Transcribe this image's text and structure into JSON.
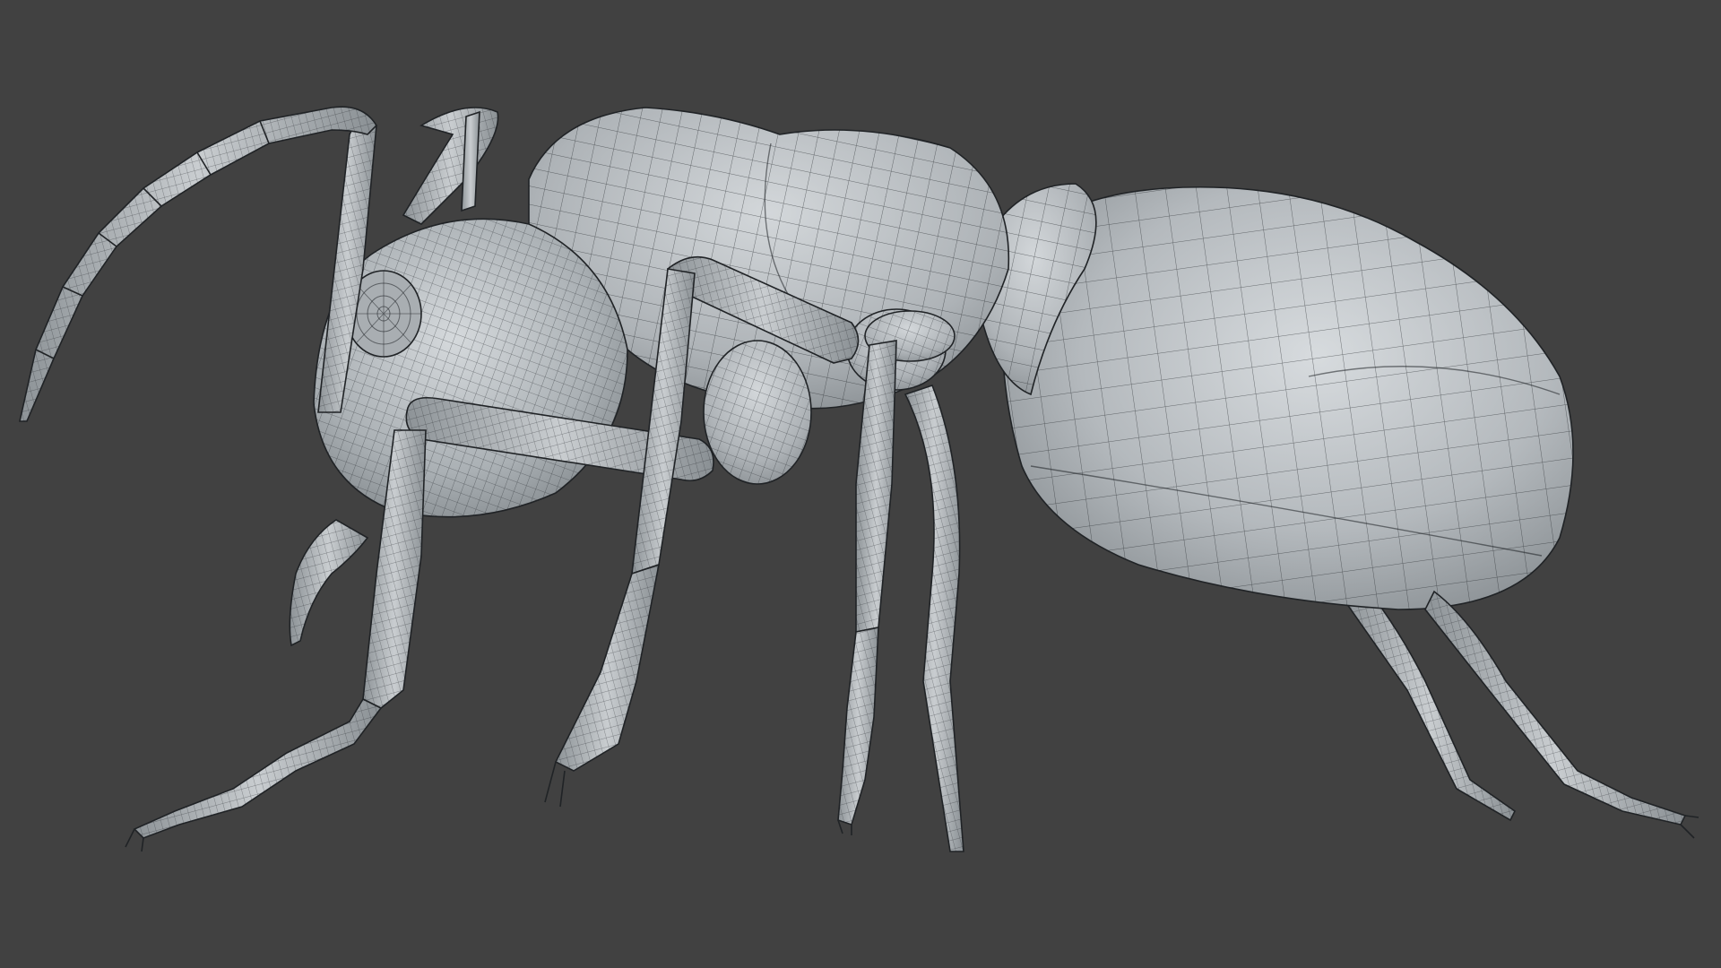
{
  "viewport": {
    "background_color": "#414141",
    "subject": "ant-wireframe-model",
    "mesh_color": "#b4b9be",
    "wire_color": "#1c1f22",
    "shading": "matcap-grey-with-wireframe"
  }
}
